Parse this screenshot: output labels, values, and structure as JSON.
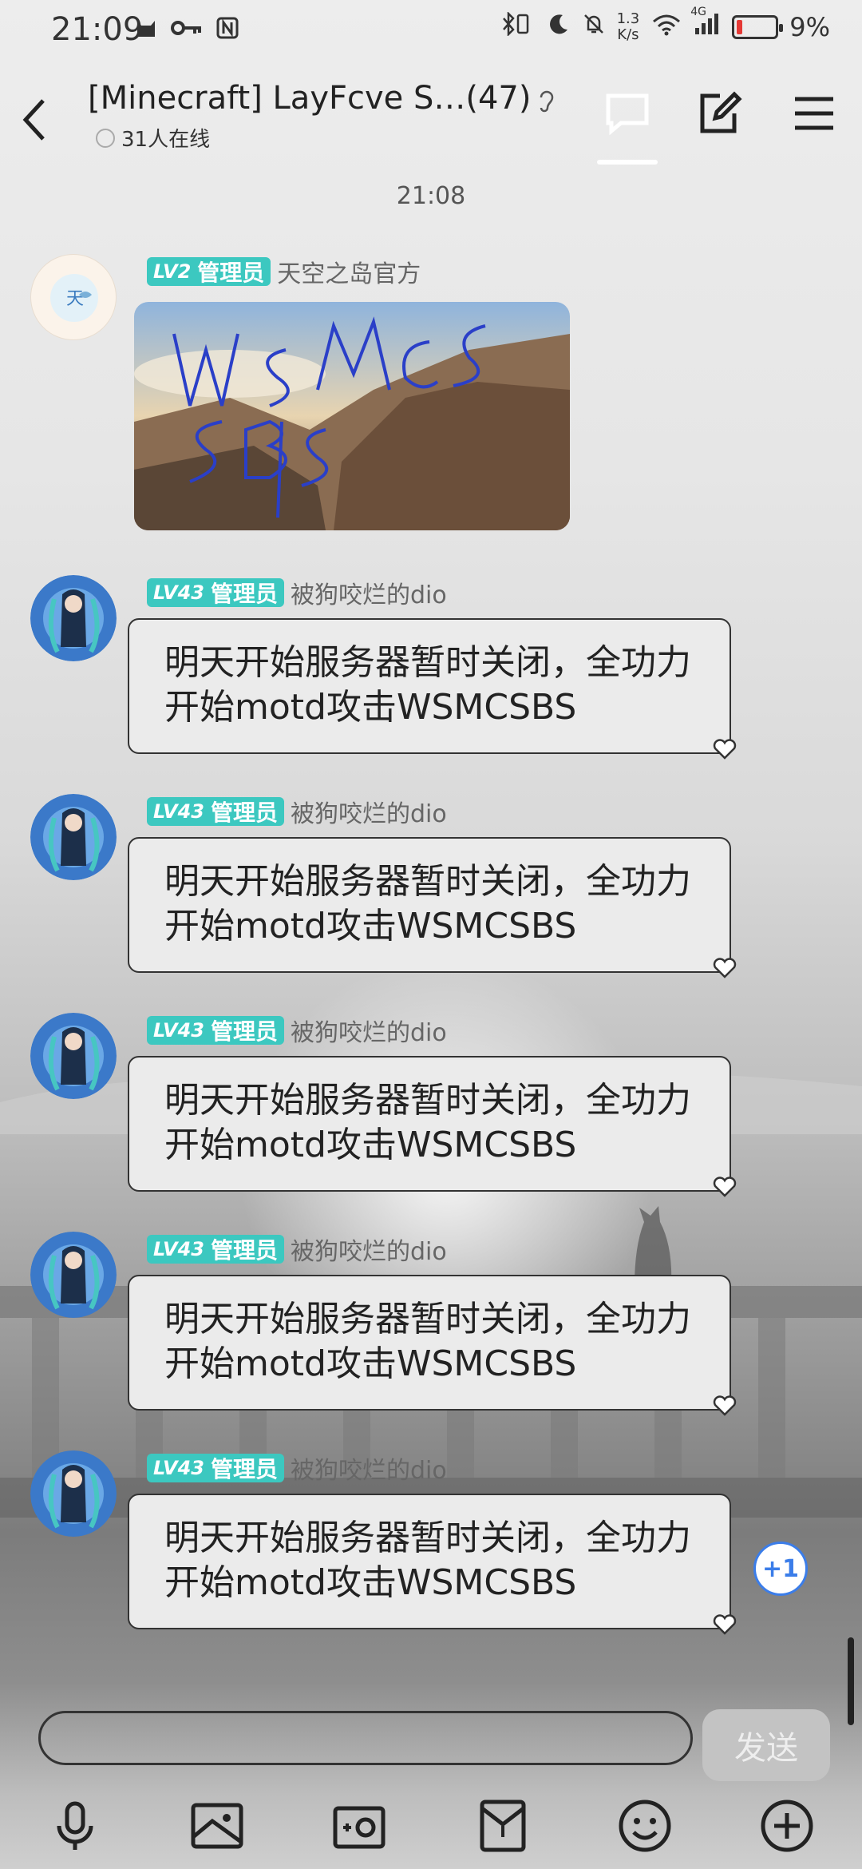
{
  "status_bar": {
    "time": "21:09",
    "net_speed_value": "1.3",
    "net_speed_unit": "K/s",
    "network": "4G",
    "battery": "9%"
  },
  "header": {
    "title": "[Minecraft] LayFcve S…(47)",
    "online": "31人在线"
  },
  "time_divider": "21:08",
  "messages": [
    {
      "level": "LV2",
      "role": "管理员",
      "name": "天空之岛官方",
      "type": "image",
      "avatar_text": "天",
      "image_scrawl": "WSMCS SBS"
    },
    {
      "level": "LV43",
      "role": "管理员",
      "name": "被狗咬烂的dio",
      "type": "text",
      "text": "明天开始服务器暂时关闭，全功力开始motd攻击WSMCSBS"
    },
    {
      "level": "LV43",
      "role": "管理员",
      "name": "被狗咬烂的dio",
      "type": "text",
      "text": "明天开始服务器暂时关闭，全功力开始motd攻击WSMCSBS"
    },
    {
      "level": "LV43",
      "role": "管理员",
      "name": "被狗咬烂的dio",
      "type": "text",
      "text": "明天开始服务器暂时关闭，全功力开始motd攻击WSMCSBS"
    },
    {
      "level": "LV43",
      "role": "管理员",
      "name": "被狗咬烂的dio",
      "type": "text",
      "text": "明天开始服务器暂时关闭，全功力开始motd攻击WSMCSBS"
    },
    {
      "level": "LV43",
      "role": "管理员",
      "name": "被狗咬烂的dio",
      "type": "text",
      "text": "明天开始服务器暂时关闭，全功力开始motd攻击WSMCSBS"
    }
  ],
  "plus_one": "+1",
  "input": {
    "placeholder": "",
    "send_label": "发送"
  },
  "toolbar_icons": [
    "microphone-icon",
    "image-icon",
    "camera-icon",
    "red-packet-icon",
    "emoji-icon",
    "plus-icon"
  ],
  "colors": {
    "badge": "#3cc8c0",
    "accent_blue": "#3b7de9",
    "battery_low": "#e53935"
  }
}
